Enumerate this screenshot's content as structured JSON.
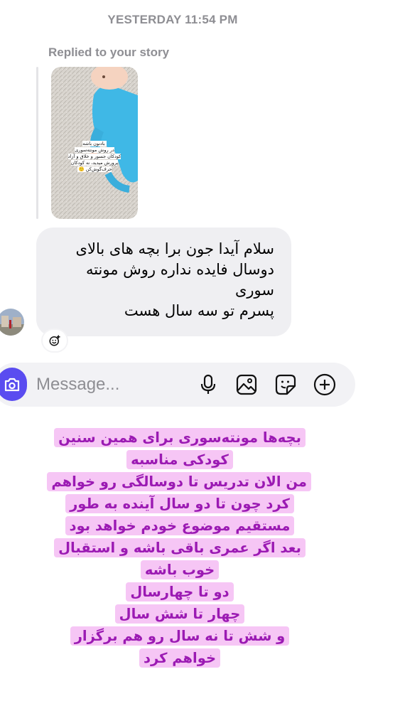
{
  "header": {
    "timestamp": "YESTERDAY 11:54 PM"
  },
  "reply": {
    "label": "Replied to your story",
    "story_caption": "با‌دنون باشه\nدر روش مونته‌سوری\nکودکان جسور و خلاق و آزاد\nپرورش میدید، نه کودکان\nحرف‌گوش‌کن 🙂"
  },
  "message": {
    "text": "سلام آیدا جون برا بچه های بالای\nدوسال فایده نداره روش مونته\nسوری\nپسرم تو سه سال هست"
  },
  "composer": {
    "placeholder": "Message...",
    "icons": [
      "camera-icon",
      "microphone-icon",
      "gallery-icon",
      "sticker-icon",
      "add-icon"
    ],
    "accent": "#5a4cf0"
  },
  "overlay": {
    "lines": [
      "بچه‌ها مونته‌سوری برای همین سنین کودکی مناسبه",
      "من الان تدریس تا دوسالگی رو خواهم کرد چون تا دو سال آینده به طور مستقیم موضوع خودم خواهد بود",
      "بعد اگر عمری باقی باشه و استقبال خوب باشه",
      "دو تا چهارسال",
      "چهار تا شش سال",
      "و شش تا نه سال رو هم برگزار خواهم کرد"
    ],
    "highlight_color": "#f6c6f5",
    "text_color": "#9b1ab3"
  }
}
